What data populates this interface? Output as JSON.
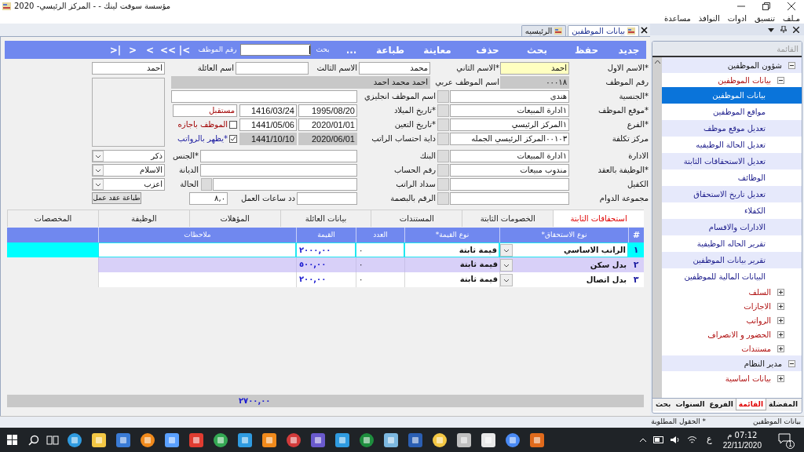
{
  "window": {
    "title": "مؤسسة سوفت لينك  -  - المركز الرئيسي- 2020"
  },
  "menu": [
    "مـلف",
    "تنسيق",
    "ادوات",
    "النوافذ",
    "مساعدة"
  ],
  "doc_tabs": [
    {
      "label": "بيانات الموظفين",
      "selected": true
    },
    {
      "label": "الرئيسيه",
      "selected": false
    }
  ],
  "toolbar": {
    "buttons": [
      "جديد",
      "حفظ",
      "بحث",
      "حذف",
      "معاينة",
      "طباعة",
      "..."
    ],
    "search_label": "بحث",
    "search_hint": "رقم الموظف",
    "nav": [
      "|<",
      "<<",
      "<",
      ">",
      ">|"
    ]
  },
  "form": {
    "rows": [
      [
        {
          "kind": "label",
          "text": "*الاسم الاول"
        },
        {
          "kind": "input",
          "value": "احمد",
          "focused": true
        },
        {
          "kind": "label",
          "text": "*الاسم الثاني"
        },
        {
          "kind": "input",
          "value": "محمد"
        },
        {
          "kind": "label",
          "text": "الاسم الثالث"
        },
        {
          "kind": "input"
        },
        {
          "kind": "label",
          "text": "اسم العائلة"
        },
        {
          "kind": "input",
          "value": "احمد"
        }
      ],
      [
        {
          "kind": "label",
          "text": "رقم الموظف"
        },
        {
          "kind": "input",
          "value": "٠٠٠١٨",
          "readonly": true
        },
        {
          "kind": "label",
          "text": "اسم الموظف عربي"
        },
        {
          "kind": "input",
          "value": "احمد محمد  احمد",
          "readonly": true
        }
      ],
      [
        {
          "kind": "label",
          "text": "*الجنسية"
        },
        {
          "kind": "input",
          "value": "هندى"
        },
        {
          "kind": "lookup"
        },
        {
          "kind": "label",
          "text": "اسم الموظف انجليزي"
        },
        {
          "kind": "input"
        }
      ],
      [
        {
          "kind": "label",
          "text": "*موقع الموظف"
        },
        {
          "kind": "input",
          "value": "١ادارة المبيعات"
        },
        {
          "kind": "lookup"
        },
        {
          "kind": "label",
          "text": "*تاريخ الميلاد"
        },
        {
          "kind": "date",
          "value": "1995/08/20"
        },
        {
          "kind": "date",
          "value": "1416/03/24"
        },
        {
          "kind": "input",
          "value": "مستقبل",
          "color": "#a00000"
        }
      ],
      [
        {
          "kind": "label",
          "text": "*الفرع"
        },
        {
          "kind": "input",
          "value": "١المركز الرئيسي"
        },
        {
          "kind": "lookup"
        },
        {
          "kind": "label",
          "text": "*تاريخ التعين"
        },
        {
          "kind": "date",
          "value": "2020/01/01"
        },
        {
          "kind": "date",
          "value": "1441/05/06"
        },
        {
          "kind": "checkbox",
          "checked": false
        },
        {
          "kind": "label",
          "text": "الموظف باجازه",
          "color": "#a00000"
        }
      ],
      [
        {
          "kind": "label",
          "text": "مركز تكلفة"
        },
        {
          "kind": "input",
          "value": "٠٠١٠٣المركز الرئيسي الجمله"
        },
        {
          "kind": "lookup"
        },
        {
          "kind": "label",
          "text": "داية احتساب الراتب"
        },
        {
          "kind": "date",
          "value": "2020/06/01",
          "readonly": true
        },
        {
          "kind": "date",
          "value": "1441/10/10",
          "readonly": true
        },
        {
          "kind": "checkbox",
          "checked": true
        },
        {
          "kind": "label",
          "text": "*يظهر بالرواتب",
          "color": "#1a1aa0"
        }
      ],
      [
        {
          "kind": "label",
          "text": "الادارة"
        },
        {
          "kind": "input",
          "value": "١ادارة المبيعات"
        },
        {
          "kind": "lookup"
        },
        {
          "kind": "label",
          "text": "البنك"
        },
        {
          "kind": "input"
        },
        {
          "kind": "label",
          "text": "*الجنس"
        },
        {
          "kind": "select",
          "value": "ذكر"
        }
      ],
      [
        {
          "kind": "label",
          "text": "*الوظيفة بالعقد"
        },
        {
          "kind": "input",
          "value": "مندوب مبيعات"
        },
        {
          "kind": "lookup"
        },
        {
          "kind": "label",
          "text": "رقم الحساب"
        },
        {
          "kind": "input"
        },
        {
          "kind": "label",
          "text": "الديانة"
        },
        {
          "kind": "select",
          "value": "الاسلام"
        }
      ],
      [
        {
          "kind": "label",
          "text": "الكفيل"
        },
        {
          "kind": "input"
        },
        {
          "kind": "lookup"
        },
        {
          "kind": "label",
          "text": "سداد الراتب"
        },
        {
          "kind": "input"
        },
        {
          "kind": "lookup"
        },
        {
          "kind": "label",
          "text": "الحالة"
        },
        {
          "kind": "select",
          "value": "اعزب"
        }
      ],
      [
        {
          "kind": "label",
          "text": "مجموعة الدوام"
        },
        {
          "kind": "input"
        },
        {
          "kind": "lookup"
        },
        {
          "kind": "label",
          "text": "الرقم بالبصمة"
        },
        {
          "kind": "input"
        },
        {
          "kind": "label",
          "text": "دد ساعات العمل"
        },
        {
          "kind": "input",
          "value": "٨,٠"
        },
        {
          "kind": "button",
          "text": "طباعة عقد عمل"
        }
      ]
    ]
  },
  "sub_tabs": [
    {
      "label": "استحقاقات الثابتة",
      "selected": true
    },
    {
      "label": "الخصومات الثابتة",
      "selected": false
    },
    {
      "label": "المستندات",
      "selected": false
    },
    {
      "label": "بيانات العائلة",
      "selected": false
    },
    {
      "label": "المؤهلات",
      "selected": false
    },
    {
      "label": "الوظيفة",
      "selected": false
    },
    {
      "label": "المخصصات",
      "selected": false
    }
  ],
  "grid": {
    "columns": [
      "#",
      "نوع الاستحقاق*",
      "نوع القيمة*",
      "العدد",
      "القيمة",
      "ملاحظات"
    ],
    "rows": [
      {
        "number": "١",
        "item": "الراتب الاساسي",
        "value_type": "قيمة ثابتة",
        "count": "٠",
        "amount": "٢٠٠٠,٠٠",
        "selected": true
      },
      {
        "number": "٢",
        "item": "بدل سكن",
        "value_type": "قيمة ثابتة",
        "count": "٠",
        "amount": "٥٠٠,٠٠",
        "selected": false
      },
      {
        "number": "٣",
        "item": "بدل اتصال",
        "value_type": "قيمة ثابتة",
        "count": "٠",
        "amount": "٢٠٠,٠٠",
        "selected": false
      }
    ],
    "total": "٢٧٠٠,٠٠"
  },
  "side_panel": {
    "title": "القائمة",
    "tree": [
      {
        "label": "شؤون الموظفين",
        "expanded": true,
        "children": [
          {
            "label": "بيانات الموظفين",
            "expanded": true,
            "children": [
              {
                "label": "بيانات الموظفين",
                "selected": true
              },
              {
                "label": "مواقع الموظفين",
                "selected": false
              },
              {
                "label": "تعديل موقع موظف",
                "selected": false
              },
              {
                "label": "تعديل الحالة الوظيفيه",
                "selected": false
              },
              {
                "label": "تعديل الاستحقاقات الثابتة",
                "selected": false
              },
              {
                "label": "الوظائف",
                "selected": false
              },
              {
                "label": "تعديل تاريخ الاستحقاق",
                "selected": false
              },
              {
                "label": "الكفلاء",
                "selected": false
              },
              {
                "label": "الادارات والاقسام",
                "selected": false
              },
              {
                "label": "تقرير الحاله الوظيفية",
                "selected": false
              },
              {
                "label": "تقرير بيانات الموظفين",
                "selected": false
              },
              {
                "label": "البيانات المالية للموظفين",
                "selected": false
              }
            ]
          },
          {
            "label": "السلف",
            "expanded": false
          },
          {
            "label": "الاجازات",
            "expanded": false
          },
          {
            "label": "الرواتب",
            "expanded": false
          },
          {
            "label": "الحضور و الانصراف",
            "expanded": false
          },
          {
            "label": "مستندات",
            "expanded": false
          }
        ]
      },
      {
        "label": "مدير النظام",
        "expanded": true,
        "children": [
          {
            "label": "بيانات اساسية",
            "expanded": false
          }
        ]
      }
    ],
    "tabs": [
      {
        "label": "المفضلة",
        "selected": false
      },
      {
        "label": "القائمة",
        "selected": true
      },
      {
        "label": "الفروع",
        "selected": false
      },
      {
        "label": "السنوات",
        "selected": false
      },
      {
        "label": "بحث",
        "selected": false
      }
    ]
  },
  "status_bar": [
    "بيانات الموظفين",
    "* الحقول المطلوبة"
  ],
  "taskbar": {
    "language": "ع",
    "time": "07:12 م",
    "date": "22/11/2020",
    "notifications": "1"
  }
}
